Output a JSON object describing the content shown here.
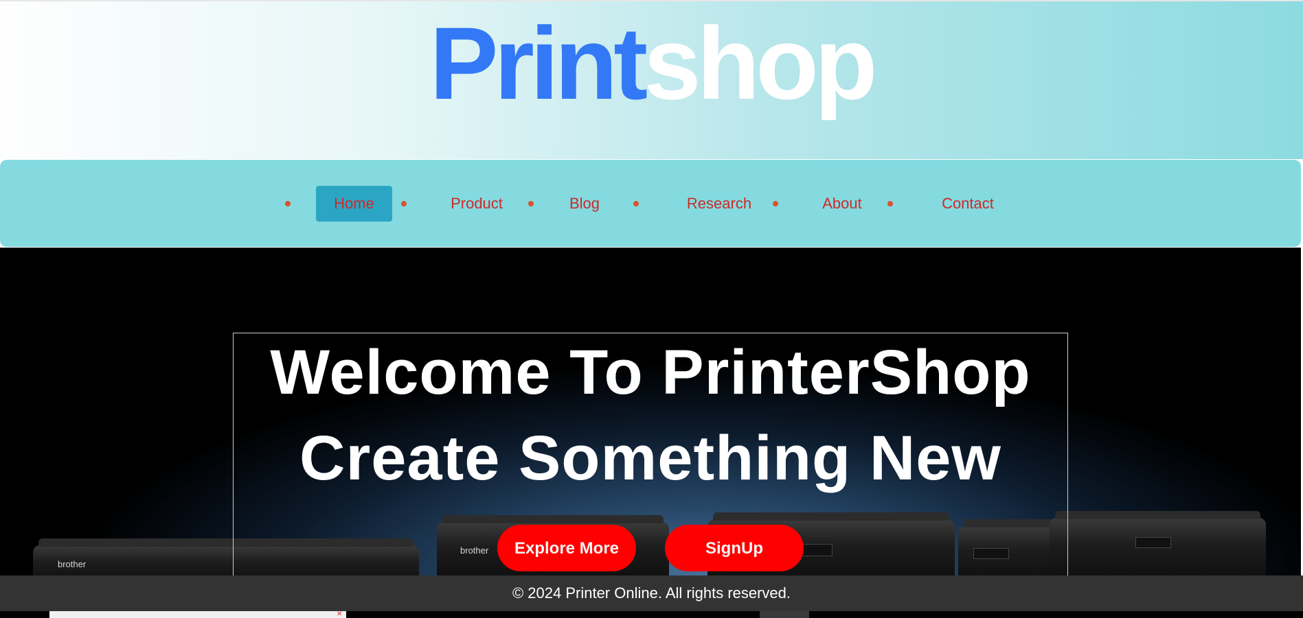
{
  "header": {
    "logo_part1": "Print",
    "logo_part2": "shop"
  },
  "nav": {
    "items": [
      {
        "label": "Home",
        "active": true
      },
      {
        "label": "Product"
      },
      {
        "label": "Blog"
      },
      {
        "label": "Research"
      },
      {
        "label": "About"
      },
      {
        "label": "Contact"
      }
    ]
  },
  "hero": {
    "title_line1": "Welcome To PrinterShop",
    "title_line2": "Create Something New",
    "buttons": {
      "explore": "Explore More",
      "signup": "SignUp"
    },
    "printer_brand": "brother"
  },
  "footer": {
    "text": "© 2024 Printer Online. All rights reserved."
  },
  "colors": {
    "logo_blue": "#3378f5",
    "nav_bg": "#84dadf",
    "nav_active": "#2aa6c4",
    "nav_text": "#cc2a2a",
    "button_red": "#ff0000",
    "footer_bg": "#333333"
  }
}
